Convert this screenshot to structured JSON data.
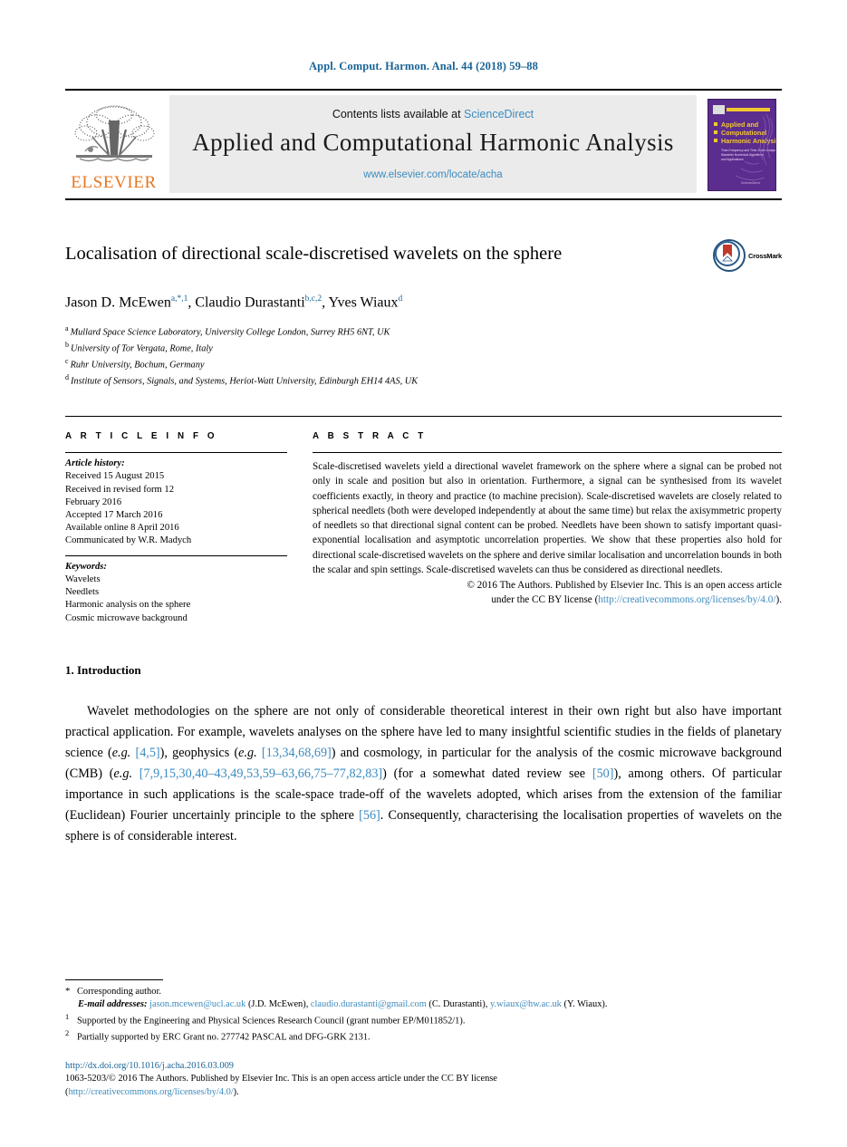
{
  "running_head": "Appl. Comput. Harmon. Anal. 44 (2018) 59–88",
  "masthead": {
    "publisher_name": "ELSEVIER",
    "contents_prefix": "Contents lists available at ",
    "contents_link": "ScienceDirect",
    "journal_title": "Applied and Computational Harmonic Analysis",
    "journal_url": "www.elsevier.com/locate/acha",
    "cover_title_line1": "Applied and",
    "cover_title_line2": "Computational",
    "cover_title_line3": "Harmonic Analysis",
    "cover_accent_color": "#f2c830",
    "cover_bg_color": "#5b2d8e"
  },
  "article": {
    "title": "Localisation of directional scale-discretised wavelets on the sphere",
    "crossmark_label": "CrossMark",
    "authors": [
      {
        "name": "Jason D. McEwen",
        "marks": "a,*,1"
      },
      {
        "name": "Claudio Durastanti",
        "marks": "b,c,2"
      },
      {
        "name": "Yves Wiaux",
        "marks": "d"
      }
    ],
    "affiliations": [
      {
        "mark": "a",
        "text": "Mullard Space Science Laboratory, University College London, Surrey RH5 6NT, UK"
      },
      {
        "mark": "b",
        "text": "University of Tor Vergata, Rome, Italy"
      },
      {
        "mark": "c",
        "text": "Ruhr University, Bochum, Germany"
      },
      {
        "mark": "d",
        "text": "Institute of Sensors, Signals, and Systems, Heriot-Watt University, Edinburgh EH14 4AS, UK"
      }
    ]
  },
  "article_info": {
    "heading": "A R T I C L E   I N F O",
    "history_label": "Article history:",
    "history_lines": [
      "Received 15 August 2015",
      "Received in revised form 12",
      "February 2016",
      "Accepted 17 March 2016",
      "Available online 8 April 2016",
      "Communicated by W.R. Madych"
    ],
    "keywords_label": "Keywords:",
    "keywords": [
      "Wavelets",
      "Needlets",
      "Harmonic analysis on the sphere",
      "Cosmic microwave background"
    ]
  },
  "abstract": {
    "heading": "A B S T R A C T",
    "text": "Scale-discretised wavelets yield a directional wavelet framework on the sphere where a signal can be probed not only in scale and position but also in orientation. Furthermore, a signal can be synthesised from its wavelet coefficients exactly, in theory and practice (to machine precision). Scale-discretised wavelets are closely related to spherical needlets (both were developed independently at about the same time) but relax the axisymmetric property of needlets so that directional signal content can be probed. Needlets have been shown to satisfy important quasi-exponential localisation and asymptotic uncorrelation properties. We show that these properties also hold for directional scale-discretised wavelets on the sphere and derive similar localisation and uncorrelation bounds in both the scalar and spin settings. Scale-discretised wavelets can thus be considered as directional needlets.",
    "copyright_line": "© 2016 The Authors. Published by Elsevier Inc. This is an open access article",
    "license_prefix": "under the CC BY license (",
    "license_link": "http://creativecommons.org/licenses/by/4.0/",
    "license_suffix": ")."
  },
  "introduction": {
    "section_number_title": "1. Introduction",
    "paragraph_parts": [
      {
        "t": "Wavelet methodologies on the sphere are not only of considerable theoretical interest in their own right but also have important practical application. For example, wavelets analyses on the sphere have led to many insightful scientific studies in the fields of planetary science (",
        "k": "plain"
      },
      {
        "t": "e.g.",
        "k": "italic"
      },
      {
        "t": " ",
        "k": "plain"
      },
      {
        "t": "[4,5]",
        "k": "ref"
      },
      {
        "t": "), geophysics (",
        "k": "plain"
      },
      {
        "t": "e.g.",
        "k": "italic"
      },
      {
        "t": " ",
        "k": "plain"
      },
      {
        "t": "[13,34,68,69]",
        "k": "ref"
      },
      {
        "t": ") and cosmology, in particular for the analysis of the cosmic microwave background (CMB) (",
        "k": "plain"
      },
      {
        "t": "e.g.",
        "k": "italic"
      },
      {
        "t": " ",
        "k": "plain"
      },
      {
        "t": "[7,9,15,30,40–43,49,53,59–63,66,75–77,82,83]",
        "k": "ref"
      },
      {
        "t": ") (for a somewhat dated review see ",
        "k": "plain"
      },
      {
        "t": "[50]",
        "k": "ref"
      },
      {
        "t": "), among others. Of particular importance in such applications is the scale-space trade-off of the wavelets adopted, which arises from the extension of the familiar (Euclidean) Fourier uncertainly principle to the sphere ",
        "k": "plain"
      },
      {
        "t": "[56]",
        "k": "ref"
      },
      {
        "t": ". Consequently, characterising the localisation properties of wavelets on the sphere is of considerable interest.",
        "k": "plain"
      }
    ]
  },
  "footnotes": {
    "corresponding": {
      "mark": "*",
      "text": "Corresponding author."
    },
    "email_label": "E-mail addresses:",
    "emails": [
      {
        "address": "jason.mcewen@ucl.ac.uk",
        "owner": "(J.D. McEwen)"
      },
      {
        "address": "claudio.durastanti@gmail.com",
        "owner": "(C. Durastanti)"
      },
      {
        "address": "y.wiaux@hw.ac.uk",
        "owner": "(Y. Wiaux)."
      }
    ],
    "note1": {
      "mark": "1",
      "text": "Supported by the Engineering and Physical Sciences Research Council (grant number EP/M011852/1)."
    },
    "note2": {
      "mark": "2",
      "text": "Partially supported by ERC Grant no. 277742 PASCAL and DFG-GRK 2131."
    }
  },
  "colophon": {
    "doi": "http://dx.doi.org/10.1016/j.acha.2016.03.009",
    "line2": "1063-5203/© 2016 The Authors. Published by Elsevier Inc. This is an open access article under the CC BY license",
    "line3_open": "(",
    "line3_link": "http://creativecommons.org/licenses/by/4.0/",
    "line3_close": ")."
  }
}
